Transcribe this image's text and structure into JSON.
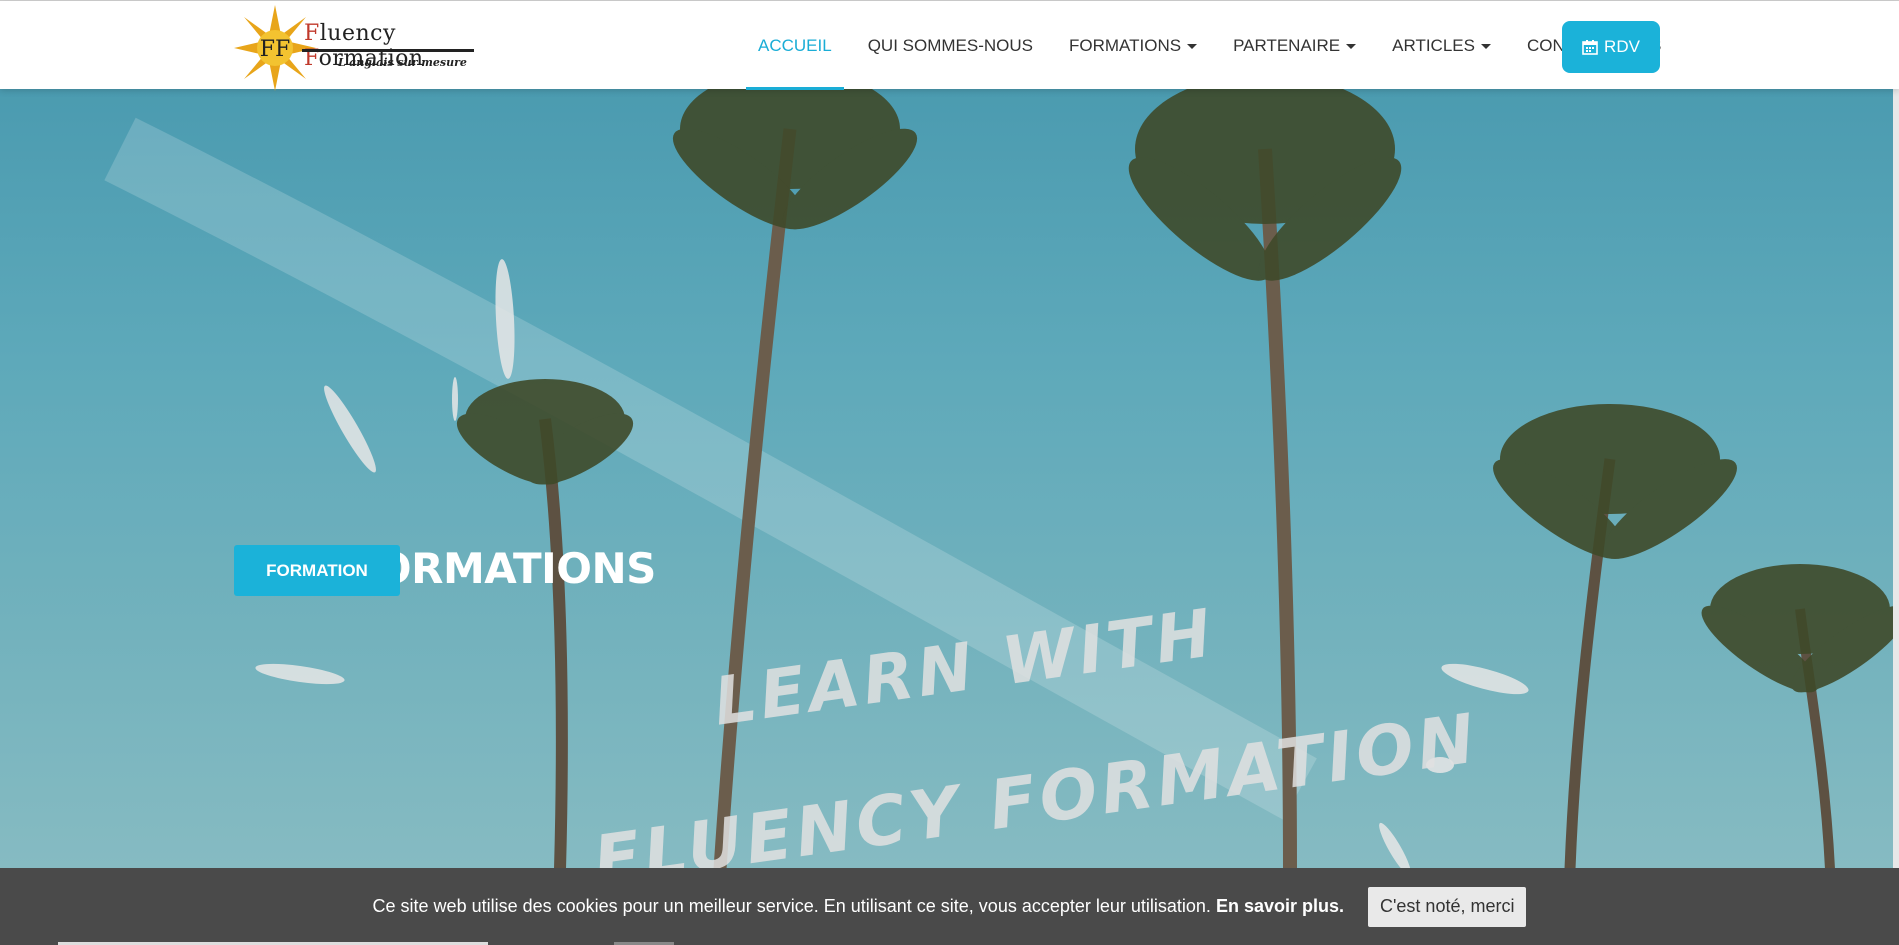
{
  "brand": {
    "logo_monogram": "FF",
    "name_part1": "F",
    "name_part2": "luency ",
    "name_part3": "F",
    "name_part4": "ormation",
    "tagline": "L'anglais sur mesure"
  },
  "nav": {
    "items": [
      {
        "label": "ACCUEIL",
        "active": true,
        "dropdown": false
      },
      {
        "label": "QUI SOMMES-NOUS",
        "active": false,
        "dropdown": false
      },
      {
        "label": "FORMATIONS",
        "active": false,
        "dropdown": true
      },
      {
        "label": "PARTENAIRE",
        "active": false,
        "dropdown": true
      },
      {
        "label": "ARTICLES",
        "active": false,
        "dropdown": true
      },
      {
        "label": "CONTACT NOUS",
        "active": false,
        "dropdown": false
      }
    ],
    "cta_label": "RDV",
    "cta_icon": "calendar-icon"
  },
  "hero": {
    "title": "NOS FORMATIONS",
    "button_label": "FORMATION",
    "watermark_line1": "LEARN WITH",
    "watermark_line2": "FLUENCY FORMATION"
  },
  "cookie": {
    "message": "Ce site web utilise des cookies pour un meilleur service. En utilisant ce site, vous accepter leur utilisation.",
    "more_label": "En savoir plus.",
    "accept_label": "C'est noté, merci"
  },
  "colors": {
    "accent": "#1bb2d9",
    "cookie_bg": "#4a4a4a",
    "logo_red": "#c0392b"
  }
}
